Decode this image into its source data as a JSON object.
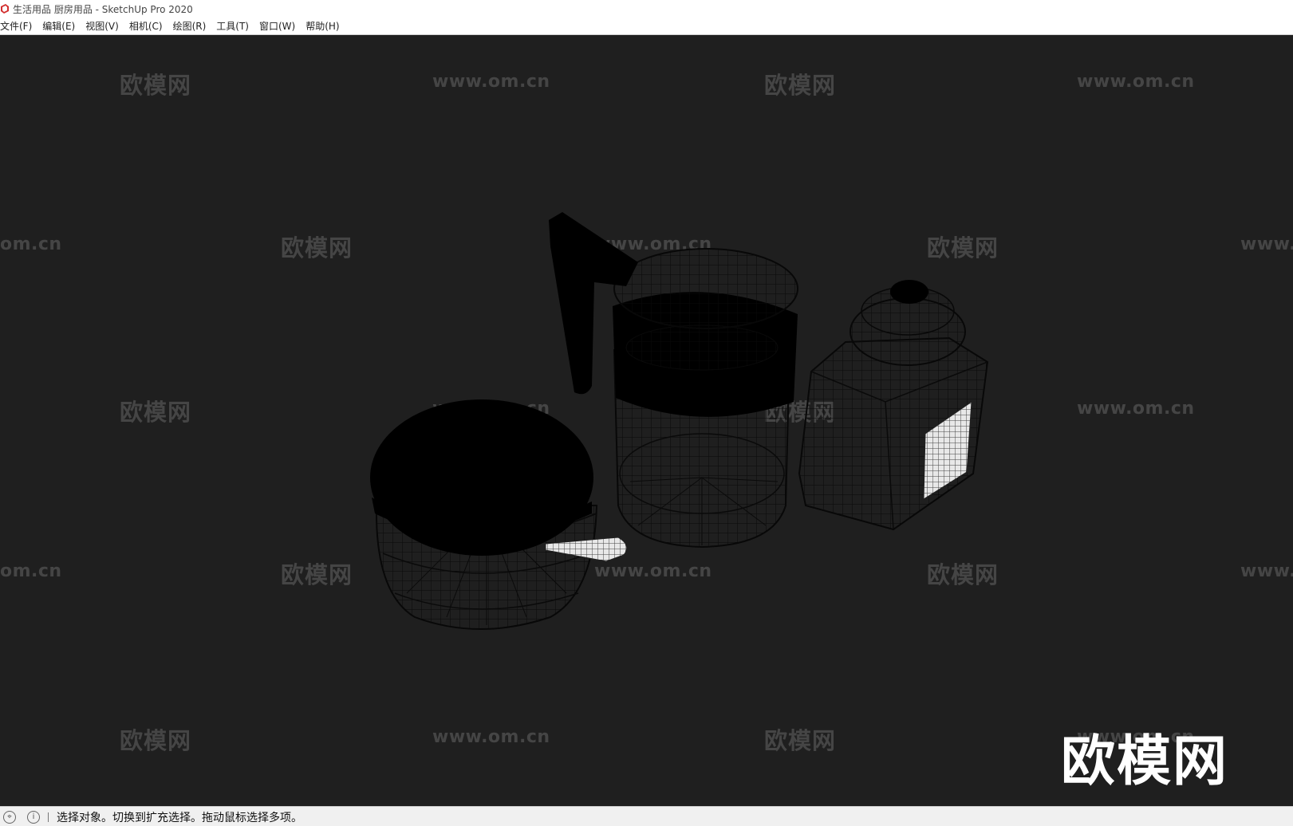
{
  "window": {
    "title": "生活用品 厨房用品 - SketchUp Pro 2020",
    "accent_color": "#d32f2f"
  },
  "menubar": {
    "items": [
      {
        "label": "文件(F)"
      },
      {
        "label": "编辑(E)"
      },
      {
        "label": "视图(V)"
      },
      {
        "label": "相机(C)"
      },
      {
        "label": "绘图(R)"
      },
      {
        "label": "工具(T)"
      },
      {
        "label": "窗口(W)"
      },
      {
        "label": "帮助(H)"
      }
    ]
  },
  "viewport": {
    "background_color": "#1f1f1f",
    "watermark_cn": "欧模网",
    "watermark_url": "www.om.cn",
    "watermark_url_left": "om.cn",
    "watermark_url_right": "www.",
    "brand_logo": "欧模网"
  },
  "statusbar": {
    "message": "选择对象。切换到扩充选择。拖动鼠标选择多项。",
    "icons": [
      "location-icon",
      "info-icon"
    ]
  }
}
